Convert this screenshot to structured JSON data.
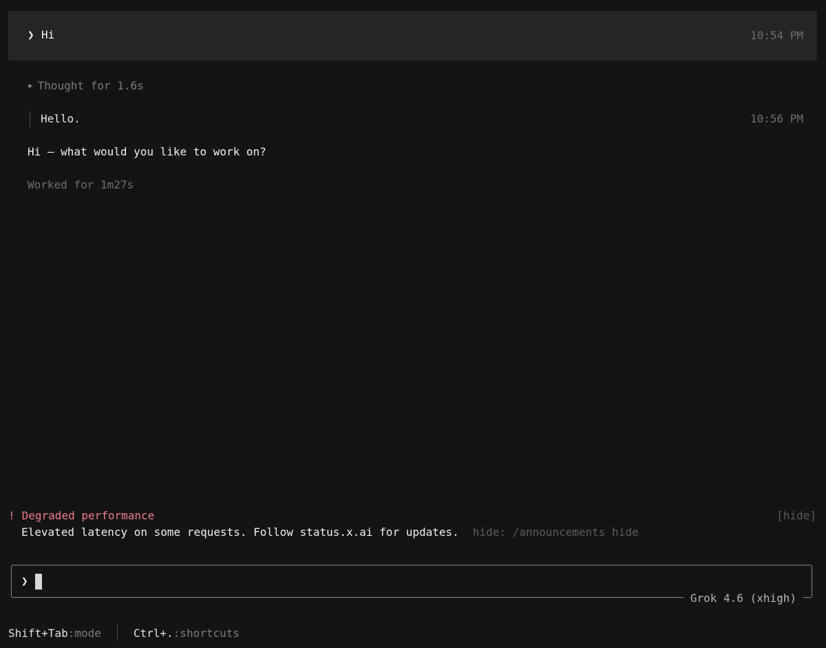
{
  "user_message": {
    "prompt_symbol": "❯",
    "text": "Hi",
    "timestamp": "10:54 PM"
  },
  "response": {
    "thought_icon": "diamond-icon",
    "thought_label": "Thought for 1.6s",
    "thought_text": "Hello.",
    "timestamp": "10:56 PM",
    "reply": "Hi — what would you like to work on?",
    "worked_label": "Worked for 1m27s"
  },
  "announcement": {
    "symbol": "!",
    "title": "Degraded performance",
    "hide_button": "[hide]",
    "body": "Elevated latency on some requests. Follow status.x.ai for updates.",
    "hint": "hide: /announcements hide"
  },
  "input": {
    "prompt_symbol": "❯",
    "value": "",
    "model": "Grok 4.6 (xhigh)"
  },
  "footer": {
    "mode_key": "Shift+Tab",
    "mode_label": ":mode",
    "shortcuts_key": "Ctrl+.",
    "shortcuts_label": ":shortcuts"
  },
  "colors": {
    "background": "#141414",
    "user_block": "#252525",
    "alert": "#ec7d8d",
    "muted": "#6f6f6f"
  }
}
